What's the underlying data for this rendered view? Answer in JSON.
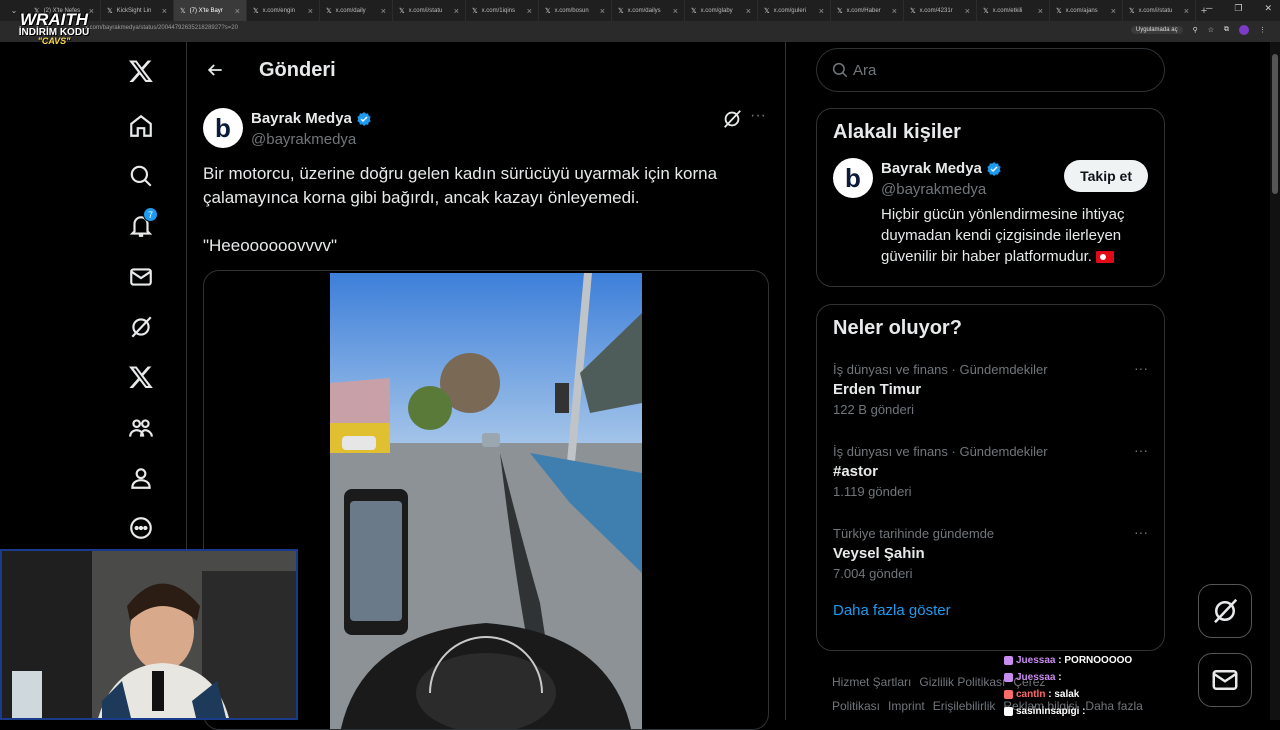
{
  "browser": {
    "tabs": [
      {
        "label": "(2) X'te Nefes",
        "active": false
      },
      {
        "label": "KickSight Lin",
        "active": false
      },
      {
        "label": "(7) X'te Bayr",
        "active": true
      },
      {
        "label": "x.com/engin",
        "active": false
      },
      {
        "label": "x.com/daily",
        "active": false
      },
      {
        "label": "x.com/i/statu",
        "active": false
      },
      {
        "label": "x.com/1iqins",
        "active": false
      },
      {
        "label": "x.com/bosun",
        "active": false
      },
      {
        "label": "x.com/dailys",
        "active": false
      },
      {
        "label": "x.com/glaby",
        "active": false
      },
      {
        "label": "x.com/guleri",
        "active": false
      },
      {
        "label": "x.com/Haber",
        "active": false
      },
      {
        "label": "x.com/4231r",
        "active": false
      },
      {
        "label": "x.com/etkili",
        "active": false
      },
      {
        "label": "x.com/ajans",
        "active": false
      },
      {
        "label": "x.com/i/statu",
        "active": false
      }
    ],
    "url": "x.com/bayrakmedya/status/2004479263521828927?s=20",
    "app_label": "Uygulamada aç"
  },
  "overlay": {
    "logo_line1": "WRAITH",
    "logo_line2": "İNDİRİM KODU",
    "logo_line3": "\"CAVS\""
  },
  "nav": {
    "notifications_badge": "7",
    "items": [
      "x-logo",
      "home",
      "explore",
      "notifications",
      "messages",
      "grok",
      "premium",
      "communities",
      "profile",
      "more"
    ]
  },
  "header": {
    "title": "Gönderi"
  },
  "post": {
    "author_name": "Bayrak Medya",
    "author_handle": "@bayrakmedya",
    "avatar_letter": "b",
    "text_1": "Bir motorcu, üzerine doğru gelen kadın sürücüyü uyarmak için korna çalamayınca korna gibi bağırdı, ancak kazayı önleyemedi.",
    "text_2": "\"Heeoooooovvvv\""
  },
  "search": {
    "placeholder": "Ara"
  },
  "related": {
    "title": "Alakalı kişiler",
    "name": "Bayrak Medya",
    "handle": "@bayrakmedya",
    "follow_label": "Takip et",
    "bio": "Hiçbir gücün yönlendirmesine ihtiyaç duymadan kendi çizgisinde ilerleyen güvenilir bir haber platformudur."
  },
  "trends": {
    "title": "Neler oluyor?",
    "items": [
      {
        "meta": "İş dünyası ve finans · Gündemdekiler",
        "name": "Erden Timur",
        "count": "122 B gönderi"
      },
      {
        "meta": "İş dünyası ve finans · Gündemdekiler",
        "name": "#astor",
        "count": "1.119 gönderi"
      },
      {
        "meta": "Türkiye tarihinde gündemde",
        "name": "Veysel Şahin",
        "count": "7.004 gönderi"
      }
    ],
    "show_more": "Daha fazla göster"
  },
  "footer": {
    "links": [
      "Hizmet Şartları",
      "Gizlilik Politikası",
      "Çerez Politikası",
      "Imprint",
      "Erişilebilirlik",
      "Reklam bilgisi",
      "Daha fazla"
    ]
  },
  "chat": [
    {
      "user": "Juessaa",
      "msg": "PORNOOOOO",
      "color": "#c98cf0"
    },
    {
      "user": "Juessaa",
      "msg": "",
      "color": "#c98cf0"
    },
    {
      "user": "cantln",
      "msg": "salak",
      "color": "#ff6b6b"
    },
    {
      "user": "sasininsapigi",
      "msg": "",
      "color": "#ffffff"
    }
  ],
  "colors": {
    "accent": "#1d9bf0",
    "background": "#000000",
    "border": "#2f3336",
    "muted_text": "#71767b"
  }
}
